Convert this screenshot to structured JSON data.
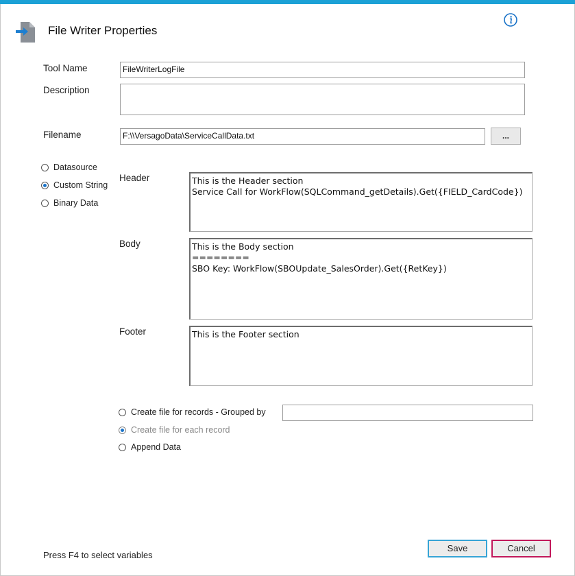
{
  "window": {
    "title": "File Writer Properties",
    "title_icon": "file-export-icon",
    "info_icon": "info-icon",
    "accent_color": "#1ba1d6"
  },
  "form": {
    "tool_name_label": "Tool Name",
    "tool_name_value": "FileWriterLogFile",
    "description_label": "Description",
    "description_value": "",
    "filename_label": "Filename",
    "filename_value": "F:\\\\VersagoData\\ServiceCallData.txt",
    "browse_label": "..."
  },
  "source_options": [
    {
      "label": "Datasource",
      "selected": false
    },
    {
      "label": "Custom String",
      "selected": true
    },
    {
      "label": "Binary Data",
      "selected": false
    }
  ],
  "sections": {
    "header_label": "Header",
    "header_text": "This is the Header section\nService Call for WorkFlow(SQLCommand_getDetails).Get({FIELD_CardCode})",
    "body_label": "Body",
    "body_text": "This is the Body section\n========\nSBO Key: WorkFlow(SBOUpdate_SalesOrder).Get({RetKey})",
    "footer_label": "Footer",
    "footer_text": "This is the Footer section"
  },
  "file_mode_options": [
    {
      "label": "Create file for records - Grouped by",
      "selected": false,
      "disabled": false
    },
    {
      "label": "Create file for each record",
      "selected": true,
      "disabled": true
    },
    {
      "label": "Append Data",
      "selected": false,
      "disabled": false
    }
  ],
  "grouped_by_value": "",
  "footer": {
    "hint": "Press F4 to select variables",
    "save_label": "Save",
    "cancel_label": "Cancel",
    "save_border_color": "#36a4d6",
    "cancel_border_color": "#c2185b"
  }
}
